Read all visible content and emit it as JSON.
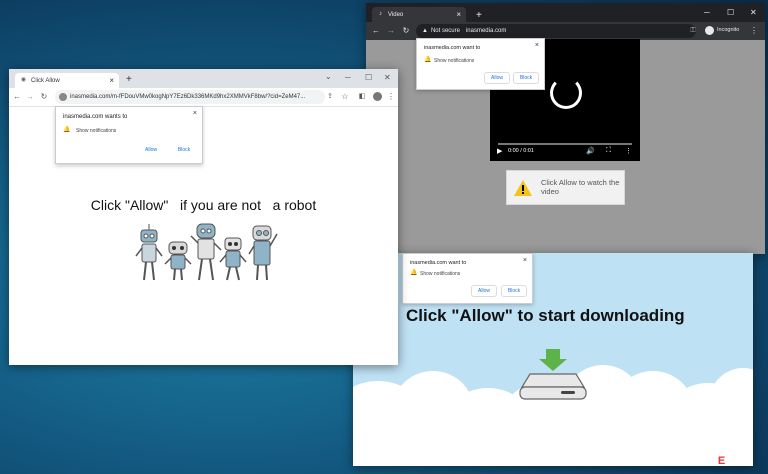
{
  "colors": {
    "chrome_light_tabbar": "#dee1e6",
    "chrome_light_toolbar": "#ffffff",
    "chrome_dark_tabbar": "#202124",
    "chrome_dark_toolbar": "#35363a",
    "download_sky": "#bfe1f4",
    "link_blue": "#1a73e8"
  },
  "win_left": {
    "tab_title": "Click Allow",
    "url": "inasmedia.com/m-fFDouVMw0kogNpY7Ez6Dk336MKd9hx2XMMVkF8bw/?cid=ZeM47...",
    "popup": {
      "title": "inasmedia.com wants to",
      "show": "Show notifications",
      "allow": "Allow",
      "block": "Block"
    },
    "heading": "Click \"Allow\"   if you are not   a robot"
  },
  "win_video": {
    "tab_title": "Video",
    "not_secure": "Not secure",
    "url": "inasmedia.com",
    "incognito": "Incognito",
    "popup": {
      "title": "inasmedia.com want to",
      "show": "Show notifications",
      "allow": "Allow",
      "block": "Block"
    },
    "video_time": "0:00 / 0:01",
    "warning": "Click Allow to watch the video"
  },
  "win_download": {
    "popup": {
      "title": "inasmedia.com want to",
      "show": "Show notifications",
      "allow": "Allow",
      "block": "Block"
    },
    "heading": "Click \"Allow\" to start downloading"
  },
  "watermark": {
    "prefix": "2",
    "brand": "SPYWAR",
    "suffix": "E"
  }
}
